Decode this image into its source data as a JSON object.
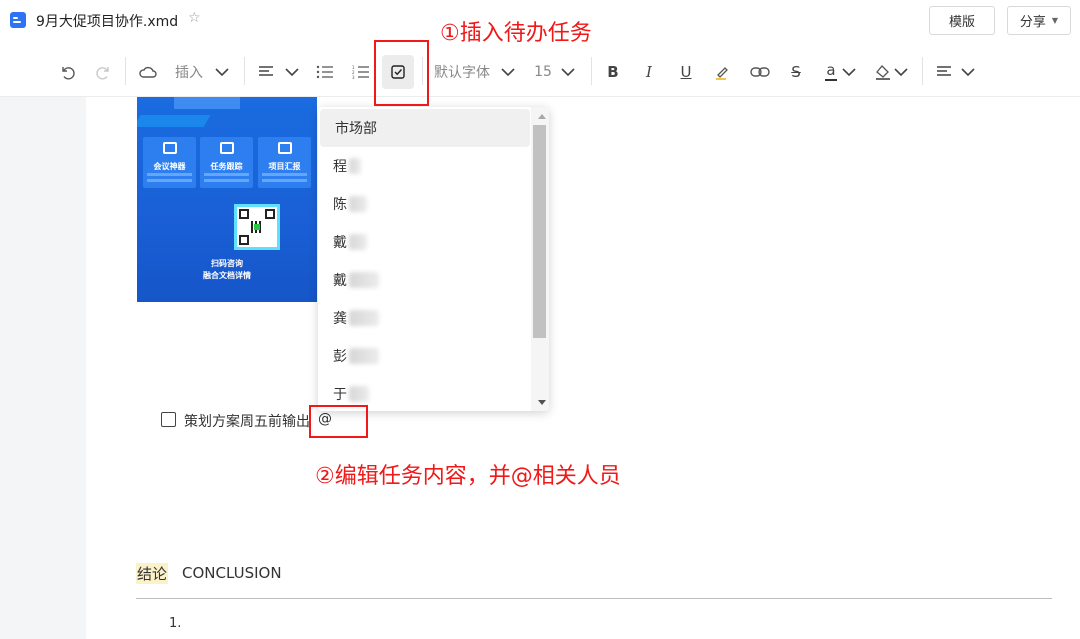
{
  "titlebar": {
    "doc_title": "9月大促项目协作.xmd",
    "template_button": "模版",
    "share_button": "分享",
    "icons": [
      "doc-icon",
      "star-icon",
      "chevron-down-icon"
    ]
  },
  "toolbar": {
    "insert_label": "插入",
    "font_label": "默认字体",
    "font_size": "15",
    "bold": "B",
    "italic": "I",
    "underline": "U",
    "strikethrough": "S",
    "font_color_glyph": "a",
    "icons": [
      "undo-icon",
      "redo-icon",
      "insert-cloud-icon",
      "paragraph-icon",
      "bullet-list-icon",
      "numbered-list-icon",
      "todo-checkbox-icon",
      "highlight-pen-icon",
      "link-icon",
      "font-color-icon",
      "fill-color-icon",
      "align-icon"
    ],
    "active_tool": "todo-checkbox-icon"
  },
  "promo_image": {
    "cards": [
      {
        "title": "会议神器"
      },
      {
        "title": "任务跟踪"
      },
      {
        "title": "项目汇报"
      }
    ],
    "caption_line1": "扫码咨询",
    "caption_line2": "融合文档详情"
  },
  "task": {
    "checked": false,
    "text": "策划方案周五前输出",
    "mention_trigger": "@"
  },
  "mention_dropdown": {
    "items": [
      {
        "label": "市场部",
        "highlighted": true
      },
      {
        "label": "程",
        "highlighted": false
      },
      {
        "label": "陈",
        "highlighted": false
      },
      {
        "label": "戴",
        "highlighted": false
      },
      {
        "label": "戴",
        "highlighted": false
      },
      {
        "label": "龚",
        "highlighted": false
      },
      {
        "label": "彭",
        "highlighted": false
      },
      {
        "label": "于",
        "highlighted": false
      }
    ]
  },
  "annotations": {
    "step1": "①插入待办任务",
    "step2": "②编辑任务内容，并@相关人员",
    "color": "#f01818"
  },
  "conclusion": {
    "label_cn": "结论",
    "label_en": "CONCLUSION",
    "first_item_number": "1."
  },
  "colors": {
    "accent_blue": "#2f73f5",
    "highlight_yellow": "#fcf2c9"
  }
}
